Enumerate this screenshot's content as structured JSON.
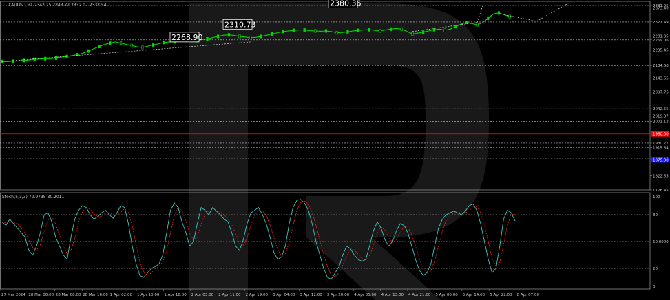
{
  "colors": {
    "background": "#000000",
    "price_line": "#00d800",
    "stoch_main": "#3cc8c0",
    "stoch_signal": "#ff2020",
    "grid": "#3a3a3a",
    "level_line": "#c8c8c8",
    "red_level": "#ff0000",
    "blue_level": "#1a1aff",
    "axis_text": "#c8c8c8"
  },
  "main_panel": {
    "header": "XAUUSD,H1  2342.25 2343.72 2332.07 2332.54",
    "price_axis_ticks": [
      "2381.25",
      "2373.40",
      "2327.49",
      "2281.35",
      "2269.06",
      "2235.45",
      "2184.68",
      "2143.65",
      "2097.75",
      "2042.55",
      "2019.37",
      "2001.13",
      "1930.21",
      "1915.84",
      "1880.44",
      "1822.55",
      "1776.45"
    ],
    "red_marker_label": "1960.00",
    "blue_marker_label": "1875.00",
    "annotations": [
      "2268.90",
      "2310.73",
      "2380.36"
    ]
  },
  "stoch_panel": {
    "header": "Stoch(5,3,3) 72.9735 80.2011",
    "axis_ticks": [
      "100",
      "80",
      "50.0000",
      "20",
      "0"
    ]
  },
  "time_axis": {
    "labels": [
      "27 Mar 2024",
      "28 Mar 00:00",
      "28 Mar 08:00",
      "28 Mar 16:00",
      "1 Apr 02:00",
      "1 Apr 10:00",
      "1 Apr 18:00",
      "2 Apr 03:00",
      "2 Apr 11:00",
      "2 Apr 19:00",
      "3 Apr 04:00",
      "3 Apr 12:00",
      "3 Apr 20:00",
      "4 Apr 05:00",
      "4 Apr 13:00",
      "4 Apr 21:00",
      "5 Apr 06:00",
      "5 Apr 14:00",
      "5 Apr 22:00",
      "8 Apr 07:00"
    ]
  },
  "chart_data": [
    {
      "type": "line",
      "title": "XAUUSD,H1",
      "xlabel": "",
      "ylabel": "",
      "ylim": [
        1776.45,
        2395
      ],
      "grid": false,
      "levels": [
        2381.25,
        2327.49,
        2269.06,
        2184.68,
        2042.55,
        2019.37,
        2001.13,
        1960.0,
        1930.21,
        1915.84,
        1880.44,
        1875.0
      ],
      "series": [
        {
          "values": [
            2198,
            2198,
            2199,
            2200,
            2201,
            2203,
            2205,
            2206,
            2207,
            2207,
            2209,
            2212,
            2214,
            2217,
            2220,
            2225,
            2232,
            2240,
            2247,
            2254,
            2258,
            2262,
            2258,
            2254,
            2250,
            2246,
            2244,
            2248,
            2252,
            2256,
            2260,
            2262,
            2262,
            2264,
            2267,
            2268,
            2266,
            2270,
            2272,
            2276,
            2280,
            2284,
            2285,
            2283,
            2280,
            2278,
            2276,
            2277,
            2280,
            2284,
            2288,
            2292,
            2296,
            2298,
            2300,
            2301,
            2301,
            2299,
            2298,
            2297,
            2298,
            2296,
            2292,
            2293,
            2295,
            2298,
            2300,
            2301,
            2302,
            2300,
            2298,
            2301,
            2304,
            2306,
            2304,
            2296,
            2288,
            2291,
            2294,
            2298,
            2302,
            2304,
            2300,
            2304,
            2312,
            2320,
            2326,
            2322,
            2318,
            2325,
            2340,
            2354,
            2357,
            2351,
            2345,
            2344
          ]
        }
      ]
    },
    {
      "type": "line",
      "title": "Stoch(5,3,3)",
      "ylim": [
        0,
        100
      ],
      "levels": [
        80,
        50,
        20
      ],
      "series": [
        {
          "values": [
            72,
            68,
            75,
            70,
            65,
            60,
            55,
            40,
            35,
            45,
            60,
            80,
            82,
            72,
            55,
            45,
            35,
            30,
            55,
            75,
            85,
            90,
            88,
            80,
            75,
            78,
            82,
            85,
            80,
            76,
            82,
            90,
            88,
            70,
            45,
            25,
            12,
            10,
            15,
            20,
            22,
            25,
            35,
            60,
            85,
            93,
            88,
            72,
            60,
            45,
            50,
            70,
            88,
            85,
            80,
            88,
            84,
            80,
            75,
            72,
            60,
            45,
            40,
            52,
            70,
            82,
            85,
            88,
            80,
            70,
            55,
            38,
            30,
            33,
            45,
            70,
            88,
            96,
            97,
            93,
            85,
            70,
            50,
            35,
            20,
            10,
            8,
            15,
            22,
            35,
            45,
            42,
            35,
            30,
            28,
            30,
            45,
            62,
            72,
            65,
            52,
            45,
            50,
            62,
            70,
            68,
            60,
            45,
            30,
            18,
            12,
            15,
            25,
            45,
            65,
            75,
            80,
            82,
            84,
            82,
            80,
            84,
            90,
            92,
            85,
            70,
            50,
            30,
            15,
            20,
            45,
            75,
            85,
            82,
            73
          ]
        }
      ]
    }
  ]
}
